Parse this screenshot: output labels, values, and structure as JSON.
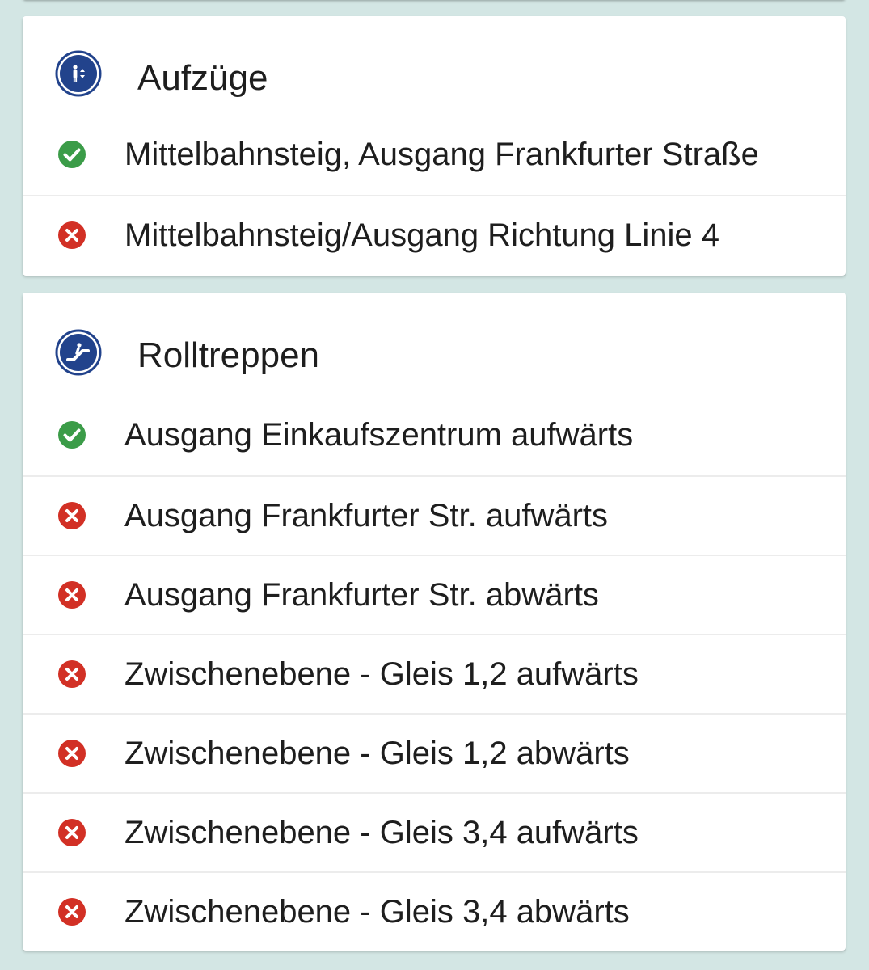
{
  "colors": {
    "background": "#d3e6e4",
    "icon_blue": "#22438c",
    "ok_green": "#3b9c48",
    "fail_red": "#d23025"
  },
  "sections": [
    {
      "title": "Aufzüge",
      "icon": "elevator-icon",
      "items": [
        {
          "label": "Mittelbahnsteig, Ausgang Frankfurter Straße",
          "status": "ok"
        },
        {
          "label": "Mittelbahnsteig/Ausgang Richtung Linie 4",
          "status": "fail"
        }
      ]
    },
    {
      "title": "Rolltreppen",
      "icon": "escalator-icon",
      "items": [
        {
          "label": "Ausgang Einkaufszentrum aufwärts",
          "status": "ok"
        },
        {
          "label": "Ausgang Frankfurter Str. aufwärts",
          "status": "fail"
        },
        {
          "label": "Ausgang Frankfurter Str. abwärts",
          "status": "fail"
        },
        {
          "label": "Zwischenebene - Gleis 1,2 aufwärts",
          "status": "fail"
        },
        {
          "label": "Zwischenebene - Gleis 1,2 abwärts",
          "status": "fail"
        },
        {
          "label": "Zwischenebene - Gleis 3,4 aufwärts",
          "status": "fail"
        },
        {
          "label": "Zwischenebene - Gleis 3,4 abwärts",
          "status": "fail"
        }
      ]
    }
  ]
}
